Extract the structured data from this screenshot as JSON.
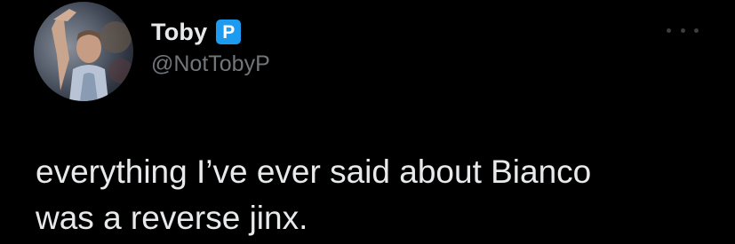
{
  "tweet": {
    "author": {
      "display_name": "Toby",
      "badge_letter": "P",
      "handle": "@NotTobyP"
    },
    "more_icon": "ellipsis-icon",
    "text": "everything I’ve ever said about Bianco\nwas a reverse jinx."
  },
  "colors": {
    "background": "#000000",
    "text_primary": "#e7e9ea",
    "text_secondary": "#71767b",
    "badge": "#1d9bf0"
  }
}
